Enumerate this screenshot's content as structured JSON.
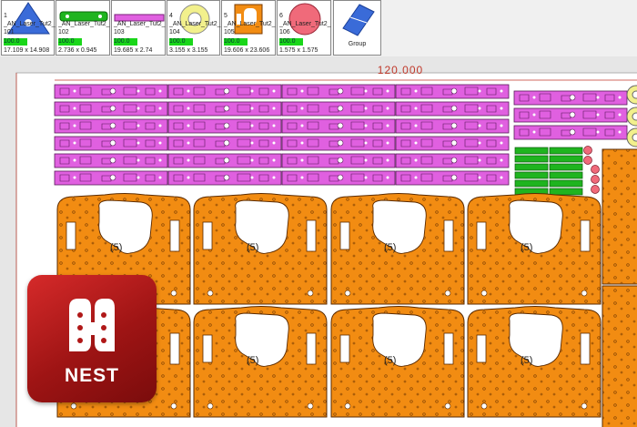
{
  "parts": [
    {
      "num": "1",
      "name": "_AN_Laser_Tut2_",
      "code": "101",
      "qty": "100.0",
      "dims": "17.109 x 14.908",
      "shape": "triangle-icon"
    },
    {
      "num": "",
      "name": "_AN_Laser_Tut2_",
      "code": "102",
      "qty": "100.0",
      "dims": "2.736 x 0.945",
      "shape": "strip-part-icon"
    },
    {
      "num": "",
      "name": "_AN_Laser_Tut2_",
      "code": "103",
      "qty": "100.0",
      "dims": "19.685 x 2.74",
      "shape": "bar-part-icon"
    },
    {
      "num": "4",
      "name": "_AN_Laser_Tut2_",
      "code": "104",
      "qty": "100.0",
      "dims": "3.155 x 3.155",
      "shape": "ring-icon"
    },
    {
      "num": "5",
      "name": "_AN_Laser_Tut2_",
      "code": "105",
      "qty": "100.0",
      "dims": "19.606 x 23.606",
      "shape": "bracket-part-icon"
    },
    {
      "num": "6",
      "name": "_AN_Laser_Tut2_",
      "code": "106",
      "qty": "100.0",
      "dims": "1.575 x 1.575",
      "shape": "disc-icon"
    }
  ],
  "group": {
    "label": "Group",
    "icon": "group-diamond-icon"
  },
  "sheet": {
    "width_label": "120.000"
  },
  "nested_part_label": "(5)",
  "colors": {
    "magenta": "#e060e0",
    "orange": "#f28c12",
    "green": "#1fb41f",
    "yellow": "#f2f08c",
    "pink": "#f06a7a",
    "sheet": "#ffffff",
    "background": "#e6e6e6"
  },
  "logo": {
    "text": "NEST",
    "icon": "nest-app-icon"
  }
}
